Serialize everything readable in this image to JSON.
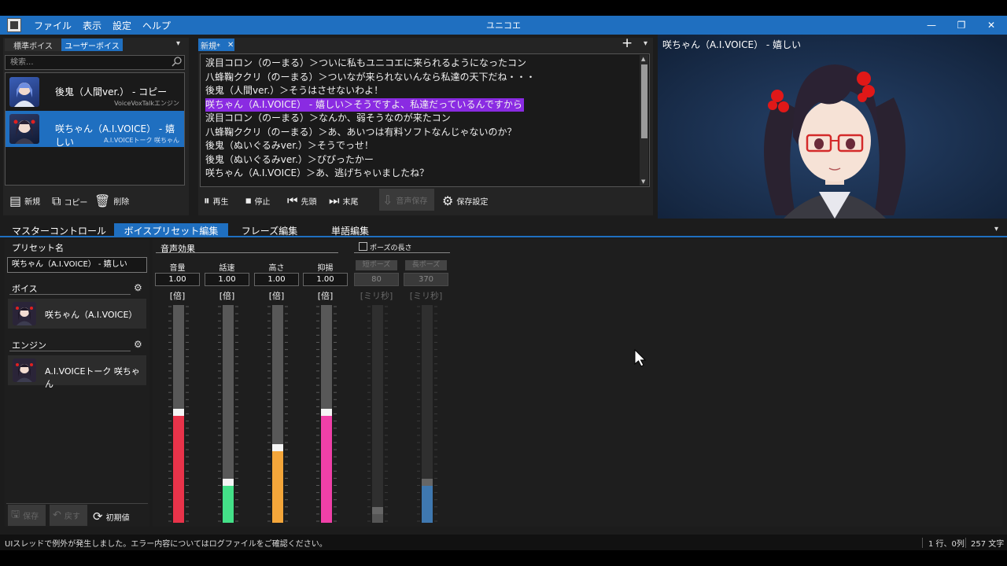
{
  "window": {
    "title": "ユニコエ",
    "menu": [
      "ファイル",
      "表示",
      "設定",
      "ヘルプ"
    ],
    "minimize": "—",
    "restore": "❐",
    "close": "✕"
  },
  "voice_panel": {
    "tabs": [
      "標準ボイス",
      "ユーザーボイス"
    ],
    "active_tab": 1,
    "search_placeholder": "検索...",
    "voices": [
      {
        "name": "後鬼（人間ver.） - コピー",
        "engine": "VoiceVoxTalkエンジン"
      },
      {
        "name": "咲ちゃん（A.I.VOICE） - 嬉しい",
        "engine": "A.I.VOICEトーク 咲ちゃん"
      }
    ],
    "selected": 1,
    "actions": [
      "新規",
      "コピー",
      "削除"
    ]
  },
  "editor": {
    "tab_label": "新規*",
    "add": "+",
    "menu": "▾",
    "lines": [
      "涙目コロン（のーまる）＞ついに私もユニコエに来られるようになったコン",
      "八蜂鞠ククリ（のーまる）＞ついなが来られないんなら私達の天下だね・・・",
      "後鬼（人間ver.）＞そうはさせないわよ！",
      "咲ちゃん（A.I.VOICE） - 嬉しい＞そうですよ、私達だっているんですから",
      "涙目コロン（のーまる）＞なんか、弱そうなのが来たコン",
      "八蜂鞠ククリ（のーまる）＞あ、あいつは有料ソフトなんじゃないのか？",
      "後鬼（ぬいぐるみver.）＞そうでっせ！",
      "後鬼（ぬいぐるみver.）＞ぴぴったかー",
      "咲ちゃん（A.I.VOICE）＞あ、逃げちゃいましたね？"
    ],
    "highlighted_line": 3,
    "playback": [
      "再生",
      "停止",
      "先頭",
      "末尾",
      "音声保存",
      "保存設定"
    ]
  },
  "image_panel": {
    "caption": "咲ちゃん（A.I.VOICE） - 嬉しい"
  },
  "lower_tabs": [
    "マスターコントロール",
    "ボイスプリセット編集",
    "フレーズ編集",
    "単語編集"
  ],
  "lower_active_tab": 1,
  "preset": {
    "name_label": "プリセット名",
    "name_value": "咲ちゃん（A.I.VOICE） - 嬉しい",
    "voice_label": "ボイス",
    "voice_value": "咲ちゃん（A.I.VOICE）",
    "engine_label": "エンジン",
    "engine_value": "A.I.VOICEトーク 咲ちゃん",
    "buttons": [
      "保存",
      "戻す",
      "初期値"
    ]
  },
  "effects": {
    "section_label": "音声効果",
    "pause_checkbox_label": "ポーズの長さ",
    "sliders": [
      {
        "label": "音量",
        "value": "1.00",
        "unit": "[倍]",
        "level": 0.49,
        "color": "#e8334a",
        "enabled": true
      },
      {
        "label": "話速",
        "value": "1.00",
        "unit": "[倍]",
        "level": 0.17,
        "color": "#44e088",
        "enabled": true
      },
      {
        "label": "高さ",
        "value": "1.00",
        "unit": "[倍]",
        "level": 0.33,
        "color": "#f4a63a",
        "enabled": true
      },
      {
        "label": "抑揚",
        "value": "1.00",
        "unit": "[倍]",
        "level": 0.49,
        "color": "#f040a8",
        "enabled": true
      },
      {
        "label": "短ポーズ",
        "value": "80",
        "unit": "[ミリ秒]",
        "level": 0.04,
        "color": "#555555",
        "enabled": false
      },
      {
        "label": "長ポーズ",
        "value": "370",
        "unit": "[ミリ秒]",
        "level": 0.17,
        "color": "#3f78b0",
        "enabled": false
      }
    ]
  },
  "status": {
    "message": "UIスレッドで例外が発生しました。エラー内容についてはログファイルをご確認ください。",
    "position": "1 行、0列",
    "chars": "257 文字"
  },
  "colors": {
    "accent": "#1f6fc0",
    "highlight": "#8a2be2",
    "panel": "#242424"
  }
}
